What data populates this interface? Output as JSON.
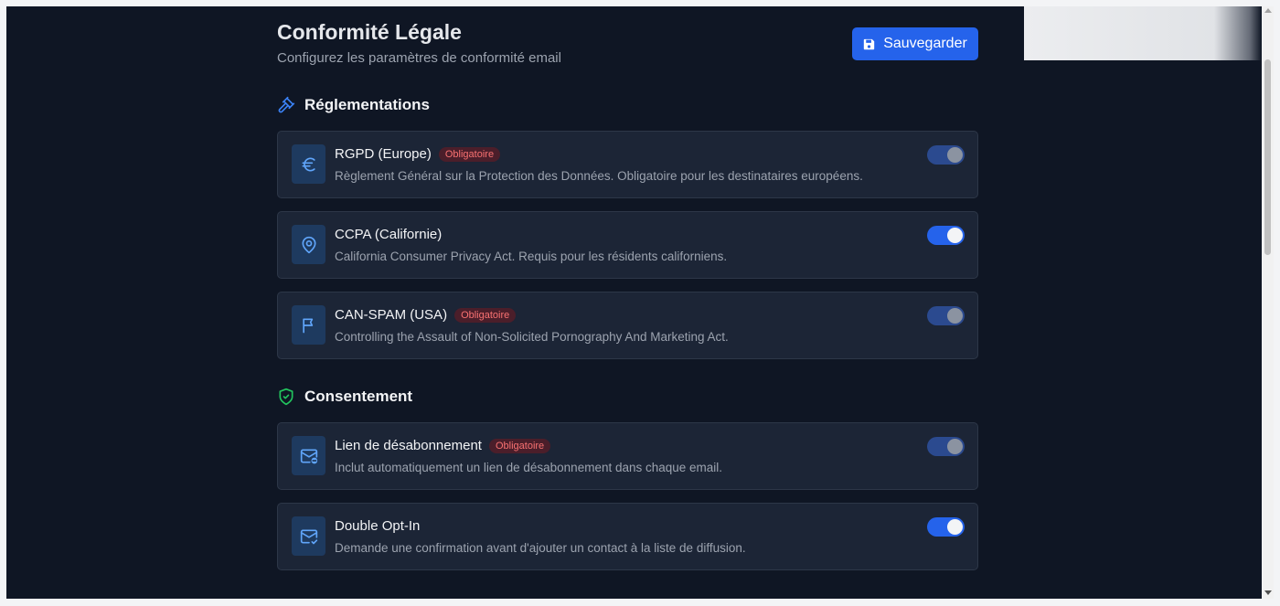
{
  "header": {
    "title": "Conformité Légale",
    "subtitle": "Configurez les paramètres de conformité email",
    "save_label": "Sauvegarder"
  },
  "sections": [
    {
      "title": "Réglementations",
      "icon": "gavel-icon",
      "items": [
        {
          "title": "RGPD (Europe)",
          "badge": "Obligatoire",
          "description": "Règlement Général sur la Protection des Données. Obligatoire pour les destinataires européens.",
          "icon": "euro-icon",
          "enabled": true,
          "locked": true
        },
        {
          "title": "CCPA (Californie)",
          "badge": "",
          "description": "California Consumer Privacy Act. Requis pour les résidents californiens.",
          "icon": "map-pin-icon",
          "enabled": true,
          "locked": false
        },
        {
          "title": "CAN-SPAM (USA)",
          "badge": "Obligatoire",
          "description": "Controlling the Assault of Non-Solicited Pornography And Marketing Act.",
          "icon": "flag-icon",
          "enabled": true,
          "locked": true
        }
      ]
    },
    {
      "title": "Consentement",
      "icon": "shield-check-icon",
      "items": [
        {
          "title": "Lien de désabonnement",
          "badge": "Obligatoire",
          "description": "Inclut automatiquement un lien de désabonnement dans chaque email.",
          "icon": "mail-minus-icon",
          "enabled": true,
          "locked": true
        },
        {
          "title": "Double Opt-In",
          "badge": "",
          "description": "Demande une confirmation avant d'ajouter un contact à la liste de diffusion.",
          "icon": "mail-check-icon",
          "enabled": true,
          "locked": false
        }
      ]
    }
  ],
  "colors": {
    "accent": "#2563eb",
    "background": "#0f1624",
    "card": "#1c2536",
    "badge_text": "#f87171",
    "shield": "#22c55e"
  }
}
